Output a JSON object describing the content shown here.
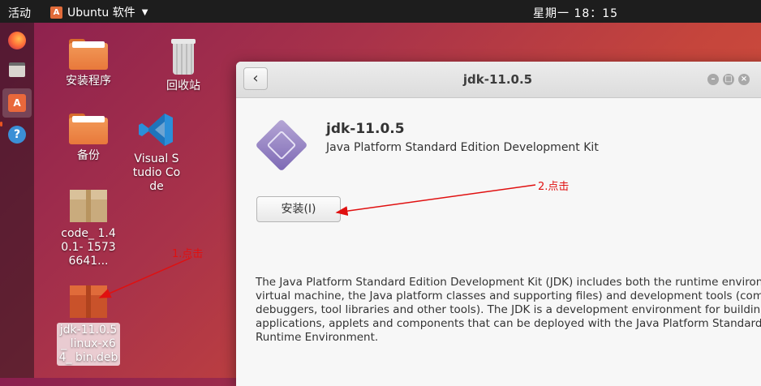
{
  "topbar": {
    "activities": "活动",
    "app_menu": "Ubuntu 软件",
    "clock": "星期一 18：15"
  },
  "dock": {
    "items": [
      {
        "name": "firefox",
        "icon": "firefox-icon"
      },
      {
        "name": "files",
        "icon": "files-icon"
      },
      {
        "name": "ubuntu-software",
        "icon": "software-icon",
        "active": true
      },
      {
        "name": "help",
        "icon": "help-icon"
      }
    ]
  },
  "desktop": {
    "icons": [
      {
        "label": "安装程序",
        "icon": "folder-icon"
      },
      {
        "label": "回收站",
        "icon": "trash-icon"
      },
      {
        "label": "备份",
        "icon": "folder-icon"
      },
      {
        "label": "Visual Studio Code",
        "icon": "vscode-icon"
      },
      {
        "label": "code_ 1.40.1- 15736641...",
        "icon": "package-icon"
      },
      {
        "label": "jdk-11.0.5_ linux-x64_ bin.deb",
        "icon": "deb-package-icon",
        "selected": true
      }
    ]
  },
  "window": {
    "title": "jdk-11.0.5",
    "package_name": "jdk-11.0.5",
    "package_summary": "Java Platform Standard Edition Development Kit",
    "install_label": "安装(I)",
    "description": "The Java Platform Standard Edition Development Kit (JDK) includes both the runtime environm\nvirtual machine, the Java platform classes and supporting files) and development tools (comp\ndebuggers, tool libraries and other tools). The JDK is a development environment for building\napplications, applets and components that can be deployed with the Java Platform Standard\nRuntime Environment."
  },
  "annotations": {
    "step1": "1.点击",
    "step2": "2.点击",
    "color": "#e01010"
  },
  "colors": {
    "accent": "#e95420",
    "topbar": "#1d1d1d"
  }
}
